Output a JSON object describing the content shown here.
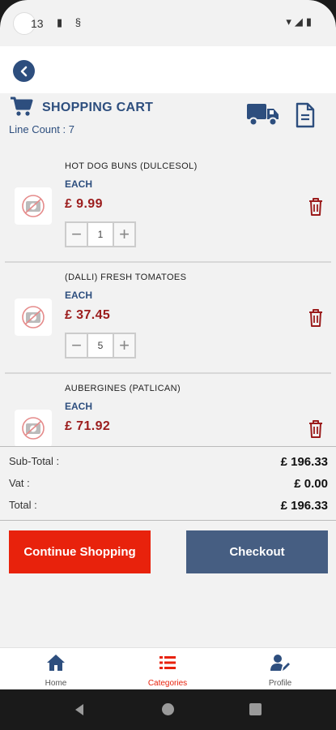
{
  "status_bar": {
    "time": "13"
  },
  "header": {
    "title": "SHOPPING CART",
    "line_count": "Line Count : 7"
  },
  "items": [
    {
      "name": "HOT DOG BUNS (DULCESOL)",
      "unit": "EACH",
      "price": "£ 9.99",
      "quantity": "1"
    },
    {
      "name": "(DALLI) FRESH TOMATOES",
      "unit": "EACH",
      "price": "£ 37.45",
      "quantity": "5"
    },
    {
      "name": "AUBERGINES (PATLICAN)",
      "unit": "EACH",
      "price": "£ 71.92",
      "quantity": ""
    }
  ],
  "totals": {
    "subtotal_label": "Sub-Total :",
    "subtotal_value": "£ 196.33",
    "vat_label": "Vat :",
    "vat_value": "£ 0.00",
    "total_label": "Total :",
    "total_value": "£ 196.33"
  },
  "actions": {
    "continue_label": "Continue Shopping",
    "checkout_label": "Checkout"
  },
  "bottom_nav": {
    "items": [
      {
        "label": "Home",
        "icon": "home-icon"
      },
      {
        "label": "Categories",
        "icon": "list-icon"
      },
      {
        "label": "Profile",
        "icon": "user-edit-icon"
      }
    ],
    "active": "Categories"
  },
  "colors": {
    "primary": "#2d4e7e",
    "price": "#9b1c1c",
    "continue_button": "#e8220c",
    "checkout_button": "#465e82",
    "active_nav": "#e8220c"
  }
}
